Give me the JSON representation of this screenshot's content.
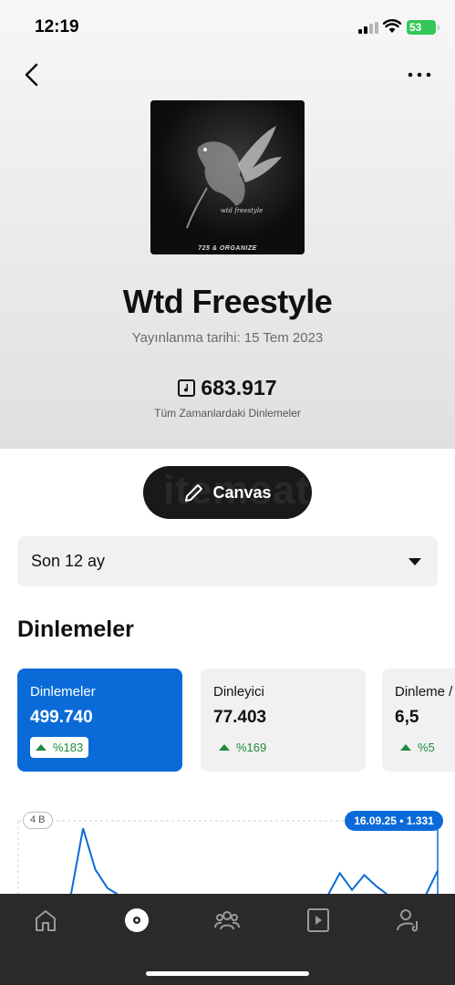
{
  "status": {
    "time": "12:19",
    "battery": "53"
  },
  "track": {
    "cover_script": "wtd freestyle",
    "cover_caption": "725 & ORGANIZE",
    "title": "Wtd Freestyle",
    "release_date": "Yayınlanma tarihi: 15 Tem 2023",
    "streams_value": "683.917",
    "streams_label": "Tüm Zamanlardaki Dinlemeler"
  },
  "canvas_button": {
    "label": "Canvas",
    "watermark": "itemsat"
  },
  "period_select": {
    "value": "Son 12 ay"
  },
  "section": {
    "title": "Dinlemeler"
  },
  "cards": [
    {
      "label": "Dinlemeler",
      "value": "499.740",
      "change": "%183"
    },
    {
      "label": "Dinleyici",
      "value": "77.403",
      "change": "%169"
    },
    {
      "label": "Dinleme / dinleyici",
      "value": "6,5",
      "change": "%5"
    }
  ],
  "chart_data": {
    "type": "line",
    "ytick_top": "4 B",
    "tooltip": "16.09.25 • 1.331",
    "series": [
      {
        "values": [
          0,
          0,
          0,
          0,
          0,
          3.6,
          1.4,
          0.4,
          0,
          0,
          0,
          0,
          0,
          0,
          0,
          0,
          0,
          0,
          0,
          0,
          0,
          0,
          0,
          0,
          0,
          0,
          1.2,
          0.3,
          1.1,
          0.5,
          0,
          0,
          0,
          0,
          1.331
        ]
      }
    ]
  },
  "tabbar": {
    "items": [
      "home",
      "releases",
      "audience",
      "music",
      "profile"
    ]
  }
}
